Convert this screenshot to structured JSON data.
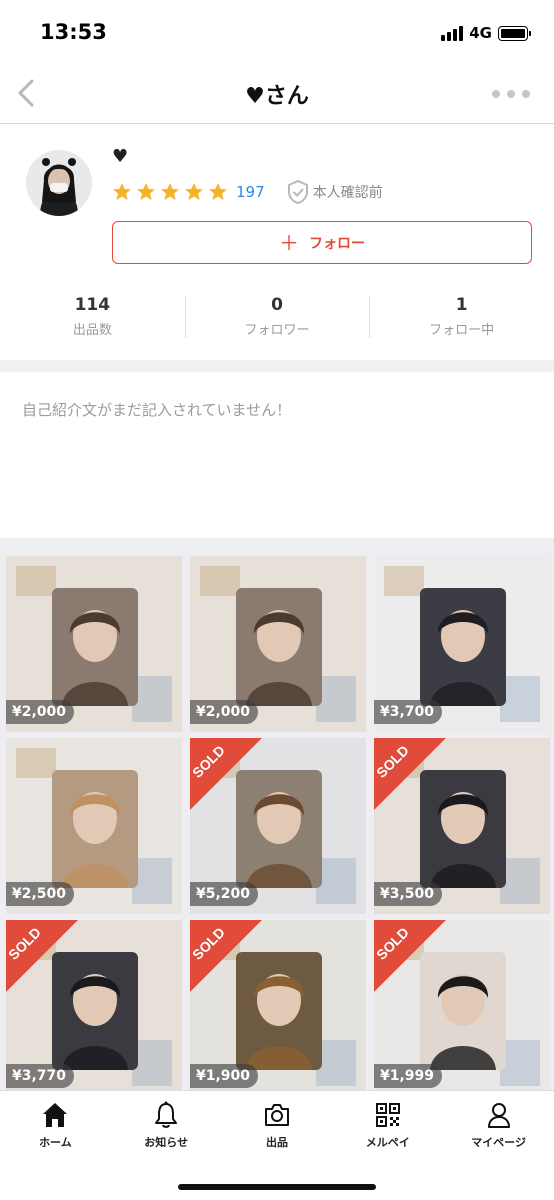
{
  "status_bar": {
    "time": "13:53",
    "network": "4G"
  },
  "header": {
    "title": "♥さん",
    "icons": [
      "back-chevron-icon",
      "more-dots-icon"
    ]
  },
  "profile": {
    "name": "♥",
    "rating_stars": 5,
    "rating_count": "197",
    "verification": "本人確認前",
    "follow_label": "フォロー",
    "stats": [
      {
        "value": "114",
        "label": "出品数"
      },
      {
        "value": "0",
        "label": "フォロワー"
      },
      {
        "value": "1",
        "label": "フォロー中"
      }
    ]
  },
  "bio": {
    "text": "自己紹介文がまだ記入されていません！"
  },
  "items": [
    {
      "price": "¥2,000",
      "sold": false
    },
    {
      "price": "¥2,000",
      "sold": false
    },
    {
      "price": "¥3,700",
      "sold": false
    },
    {
      "price": "¥2,500",
      "sold": false
    },
    {
      "price": "¥5,200",
      "sold": true
    },
    {
      "price": "¥3,500",
      "sold": true
    },
    {
      "price": "¥3,770",
      "sold": true
    },
    {
      "price": "¥1,900",
      "sold": true
    },
    {
      "price": "¥1,999",
      "sold": true
    }
  ],
  "sold_label": "SOLD",
  "tab_bar": [
    {
      "label": "ホーム",
      "icon": "home-icon",
      "active": true
    },
    {
      "label": "お知らせ",
      "icon": "bell-icon",
      "active": false
    },
    {
      "label": "出品",
      "icon": "camera-icon",
      "active": false
    },
    {
      "label": "メルペイ",
      "icon": "qr-code-icon",
      "active": false
    },
    {
      "label": "マイページ",
      "icon": "person-icon",
      "active": false
    }
  ],
  "colors": {
    "accent": "#e04b3a",
    "rating_count": "#2a8be8",
    "star": "#f5b324"
  }
}
